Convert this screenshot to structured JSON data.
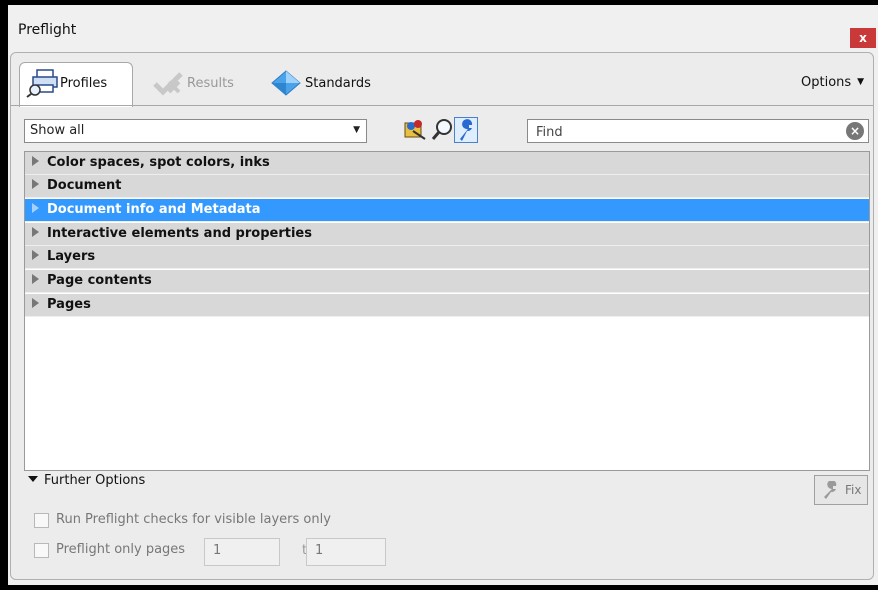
{
  "window": {
    "title": "Preflight",
    "close_label": "x"
  },
  "tabs": [
    {
      "label": "Profiles",
      "icon": "profiles-icon",
      "active": true
    },
    {
      "label": "Results",
      "icon": "results-icon",
      "active": false
    },
    {
      "label": "Standards",
      "icon": "standards-icon",
      "active": false
    }
  ],
  "options": {
    "label": "Options"
  },
  "filter": {
    "value": "Show all"
  },
  "search": {
    "placeholder": "Find"
  },
  "toolbar": {
    "icons": [
      "profile-select-icon",
      "magnifier-icon",
      "wrench-icon"
    ]
  },
  "list": {
    "items": [
      {
        "label": "Color spaces, spot colors, inks",
        "selected": false
      },
      {
        "label": "Document",
        "selected": false
      },
      {
        "label": "Document info and Metadata",
        "selected": true
      },
      {
        "label": "Interactive elements and properties",
        "selected": false
      },
      {
        "label": "Layers",
        "selected": false
      },
      {
        "label": "Page contents",
        "selected": false
      },
      {
        "label": "Pages",
        "selected": false
      }
    ]
  },
  "further_options": {
    "label": "Further Options",
    "fix_label": "Fix",
    "visible_layers_label": "Run Preflight checks for visible layers only",
    "pages_label": "Preflight only pages",
    "from_value": "1",
    "to_label": "to",
    "to_value": "1"
  },
  "colors": {
    "selected_row": "#3399ff",
    "row": "#d8d8d8",
    "close": "#c9393a"
  }
}
